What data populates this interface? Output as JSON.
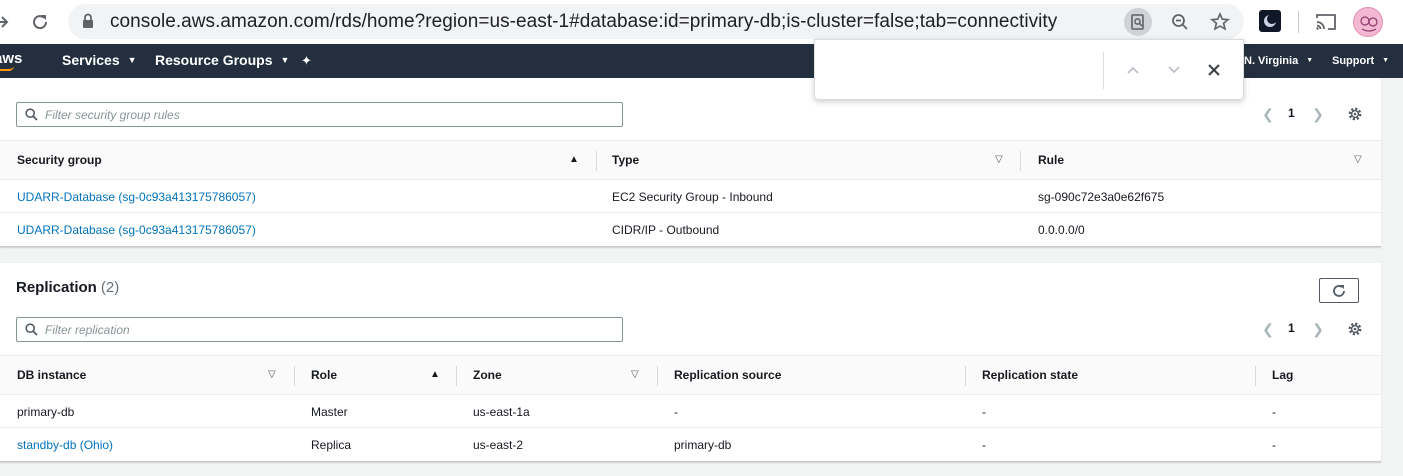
{
  "browser": {
    "url": "console.aws.amazon.com/rds/home?region=us-east-1#database:id=primary-db;is-cluster=false;tab=connectivity"
  },
  "aws_nav": {
    "logo": "aws",
    "services": "Services",
    "resource_groups": "Resource Groups",
    "region": "N. Virginia",
    "support": "Support"
  },
  "find_bar": {
    "query": ""
  },
  "security_groups": {
    "filter_placeholder": "Filter security group rules",
    "page": "1",
    "columns": [
      "Security group",
      "Type",
      "Rule"
    ],
    "rows": [
      {
        "security_group": "UDARR-Database (sg-0c93a413175786057)",
        "type": "EC2 Security Group - Inbound",
        "rule": "sg-090c72e3a0e62f675"
      },
      {
        "security_group": "UDARR-Database (sg-0c93a413175786057)",
        "type": "CIDR/IP - Outbound",
        "rule": "0.0.0.0/0"
      }
    ]
  },
  "replication": {
    "title": "Replication",
    "count": "(2)",
    "filter_placeholder": "Filter replication",
    "page": "1",
    "columns": [
      "DB instance",
      "Role",
      "Zone",
      "Replication source",
      "Replication state",
      "Lag"
    ],
    "rows": [
      {
        "db_instance": "primary-db",
        "role": "Master",
        "zone": "us-east-1a",
        "replication_source": "-",
        "replication_state": "-",
        "lag": "-"
      },
      {
        "db_instance": "standby-db (Ohio)",
        "role": "Replica",
        "zone": "us-east-2",
        "replication_source": "primary-db",
        "replication_state": "-",
        "lag": "-"
      }
    ]
  },
  "colors": {
    "aws_nav_bg": "#232f3e",
    "aws_orange": "#ff9900",
    "link": "#0073bb",
    "page_bg": "#f2f3f3"
  }
}
